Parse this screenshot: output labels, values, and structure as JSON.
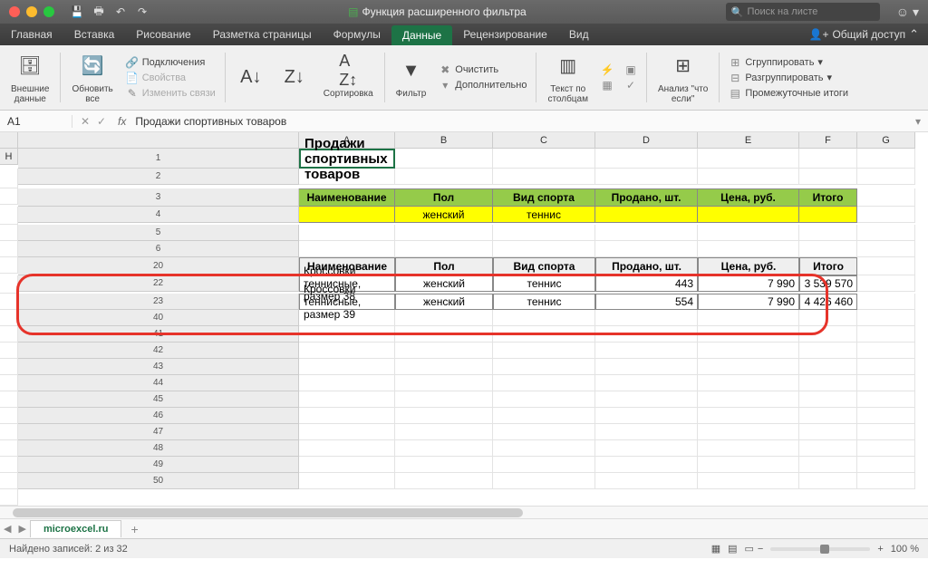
{
  "titlebar": {
    "title": "Функция расширенного фильтра",
    "search_placeholder": "Поиск на листе"
  },
  "tabs": {
    "items": [
      "Главная",
      "Вставка",
      "Рисование",
      "Разметка страницы",
      "Формулы",
      "Данные",
      "Рецензирование",
      "Вид"
    ],
    "active_index": 5,
    "share": "Общий доступ"
  },
  "ribbon": {
    "ext": "Внешние\nданные",
    "refresh": "Обновить\nвсе",
    "conn": "Подключения",
    "props": "Свойства",
    "edit": "Изменить связи",
    "sort": "Сортировка",
    "filter": "Фильтр",
    "clear": "Очистить",
    "adv": "Дополнительно",
    "textcol": "Текст по\nстолбцам",
    "whatif": "Анализ \"что\nесли\"",
    "group": "Сгруппировать",
    "ungroup": "Разгруппировать",
    "subtotal": "Промежуточные итоги"
  },
  "formula": {
    "cell": "A1",
    "value": "Продажи спортивных товаров"
  },
  "cols": [
    "A",
    "B",
    "C",
    "D",
    "E",
    "F",
    "G",
    "H"
  ],
  "rows_top": [
    1,
    2,
    3,
    4,
    5,
    6
  ],
  "rows_mid": [
    20,
    22,
    23
  ],
  "rows_bot": [
    40,
    41,
    42,
    43,
    44,
    45,
    46,
    47,
    48,
    49,
    50
  ],
  "sheet": {
    "title": "Продажи спортивных товаров",
    "headers": [
      "Наименование",
      "Пол",
      "Вид спорта",
      "Продано, шт.",
      "Цена, руб.",
      "Итого"
    ],
    "criteria": {
      "b": "женский",
      "c": "теннис"
    },
    "result": [
      {
        "a": "Кроссовки теннисные, размер 38",
        "b": "женский",
        "c": "теннис",
        "d": "443",
        "e": "7 990",
        "f": "3 539 570"
      },
      {
        "a": "Кроссовки теннисные, размер 39",
        "b": "женский",
        "c": "теннис",
        "d": "554",
        "e": "7 990",
        "f": "4 426 460"
      }
    ]
  },
  "sheettab": "microexcel.ru",
  "status": {
    "found": "Найдено записей: 2 из 32",
    "zoom": "100 %"
  }
}
